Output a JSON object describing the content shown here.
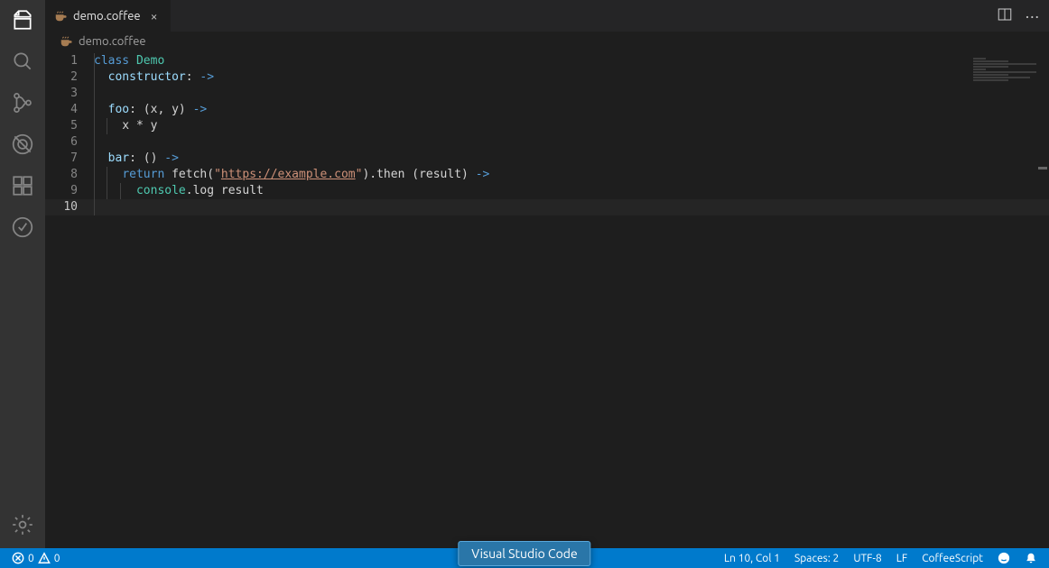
{
  "tab": {
    "filename": "demo.coffee",
    "path": "demo.coffee"
  },
  "breadcrumb": {
    "filename": "demo.coffee"
  },
  "code": {
    "lines": [
      {
        "n": 1,
        "html": "<span class='guide g0'></span><span class='tok-kw'>class</span> <span class='tok-cls'>Demo</span>"
      },
      {
        "n": 2,
        "html": "<span class='guide g0'></span>  <span class='tok-fn'>constructor</span>: <span class='tok-arrow'>-></span>"
      },
      {
        "n": 3,
        "html": "<span class='guide g0'></span>"
      },
      {
        "n": 4,
        "html": "<span class='guide g0'></span>  <span class='tok-fn'>foo</span>: (x, y) <span class='tok-arrow'>-></span>"
      },
      {
        "n": 5,
        "html": "<span class='guide g0'></span><span class='guide g1'></span>    x * y"
      },
      {
        "n": 6,
        "html": "<span class='guide g0'></span>"
      },
      {
        "n": 7,
        "html": "<span class='guide g0'></span>  <span class='tok-fn'>bar</span>: () <span class='tok-arrow'>-></span>"
      },
      {
        "n": 8,
        "html": "<span class='guide g0'></span><span class='guide g1'></span>    <span class='tok-kw'>return</span> fetch(<span class='tok-str'>\"</span><span class='tok-url'>https://example.com</span><span class='tok-str'>\"</span>).then (result) <span class='tok-arrow'>-></span>"
      },
      {
        "n": 9,
        "html": "<span class='guide g0'></span><span class='guide g1'></span><span class='guide g2'></span>      <span class='tok-lit'>console</span>.log result"
      },
      {
        "n": 10,
        "html": "<span class='guide g0'></span>",
        "current": true
      }
    ]
  },
  "status": {
    "errors": "0",
    "warnings": "0",
    "position": "Ln 10, Col 1",
    "indent": "Spaces: 2",
    "encoding": "UTF-8",
    "eol": "LF",
    "language": "CoffeeScript"
  },
  "taskbar": {
    "app_name": "Visual Studio Code"
  }
}
